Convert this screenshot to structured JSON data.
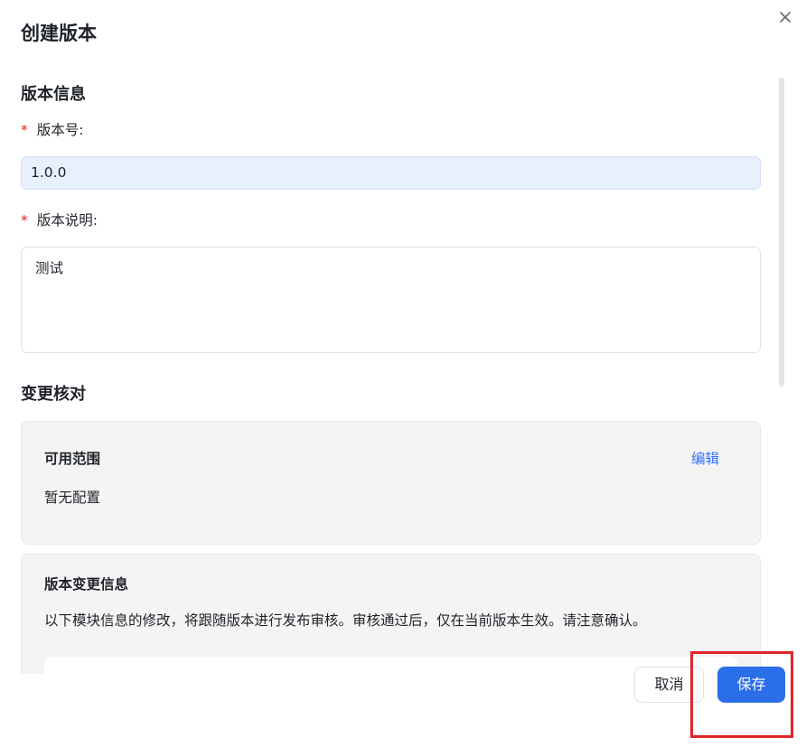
{
  "dialog": {
    "title": "创建版本",
    "close_icon": "close-icon"
  },
  "version_info": {
    "section_title": "版本信息",
    "version_number": {
      "required_mark": "*",
      "label": "版本号:",
      "value": "1.0.0"
    },
    "version_description": {
      "required_mark": "*",
      "label": "版本说明:",
      "value": "测试"
    }
  },
  "change_check": {
    "section_title": "变更核对",
    "scope_card": {
      "title": "可用范围",
      "edit_link": "编辑",
      "text": "暂无配置"
    },
    "change_card": {
      "title": "版本变更信息",
      "text": "以下模块信息的修改，将跟随版本进行发布审核。审核通过后，仅在当前版本生效。请注意确认。"
    }
  },
  "footer": {
    "cancel_label": "取消",
    "save_label": "保存"
  },
  "colors": {
    "primary": "#2a6ee8",
    "link": "#3370ff",
    "required": "#e02020",
    "highlight_border": "#e0262b"
  }
}
